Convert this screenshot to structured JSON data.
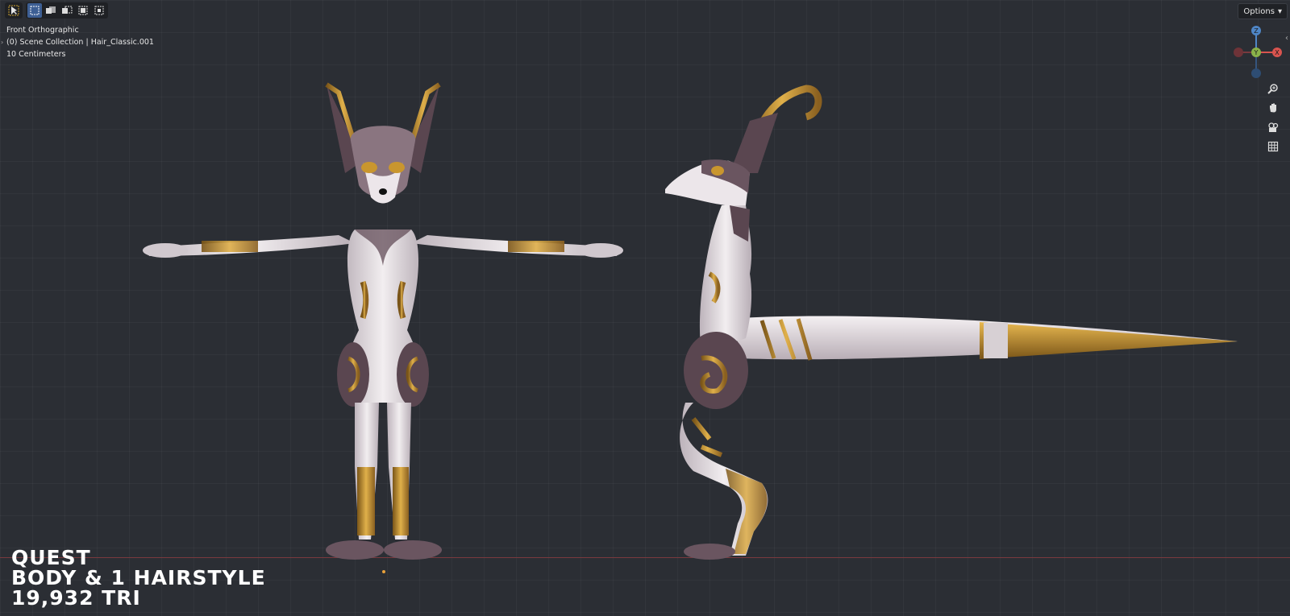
{
  "toolbar": {
    "buttons": [
      {
        "icon": "select-cursor-icon",
        "active": false
      },
      {
        "icon": "select-box-new-icon",
        "active": true
      },
      {
        "icon": "select-box-extend-icon",
        "active": false
      },
      {
        "icon": "select-box-subtract-icon",
        "active": false
      },
      {
        "icon": "select-box-invert-icon",
        "active": false
      },
      {
        "icon": "select-box-intersect-icon",
        "active": false
      }
    ]
  },
  "header": {
    "options_label": "Options"
  },
  "info": {
    "view_name": "Front Orthographic",
    "collection": "(0) Scene Collection | Hair_Classic.001",
    "scale": "10 Centimeters"
  },
  "gizmo": {
    "axes": [
      {
        "label": "Z",
        "color": "#4f86c6"
      },
      {
        "label": "Y",
        "color": "#8ab34a"
      },
      {
        "label": "X",
        "color": "#d9544f"
      }
    ]
  },
  "nav": {
    "icons": [
      "zoom-icon",
      "pan-hand-icon",
      "camera-view-icon",
      "grid-ortho-icon"
    ]
  },
  "caption": {
    "line1": "QUEST",
    "line2": "BODY & 1 HAIRSTYLE",
    "line3": "19,932 TRI"
  },
  "colors": {
    "viewport_bg": "#2b2e34",
    "body_light": "#e8e2e6",
    "body_dark": "#5a4650",
    "gold": "#c9962e"
  }
}
